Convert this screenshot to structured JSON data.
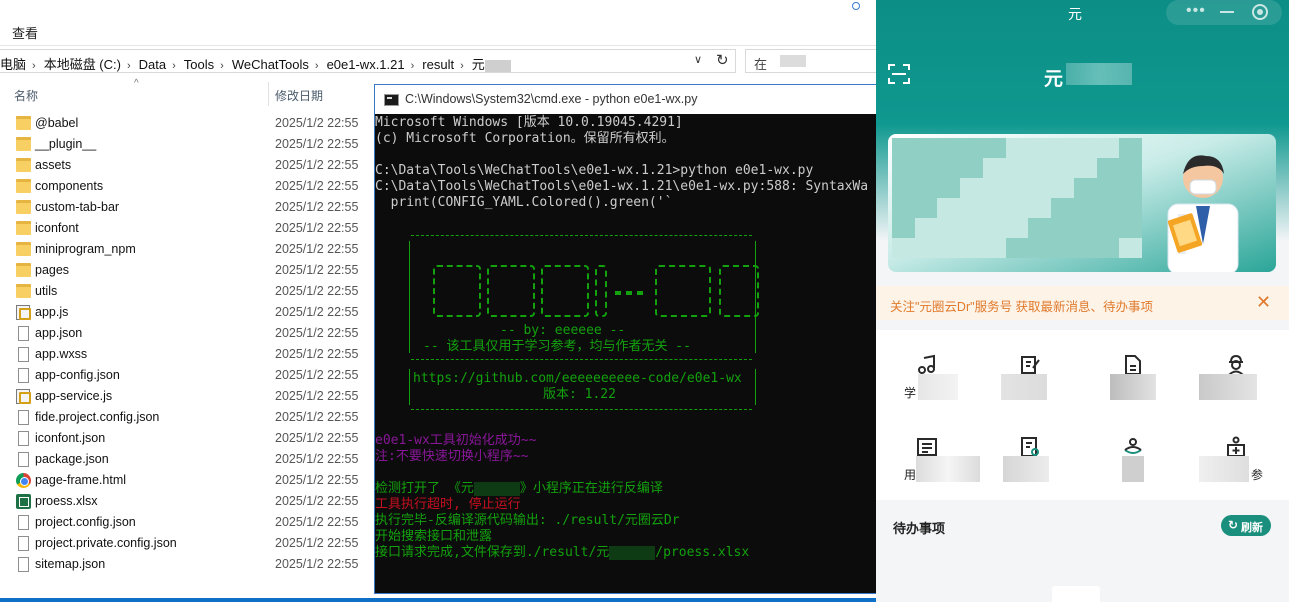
{
  "explorer": {
    "menu": "查看",
    "breadcrumb": [
      "电脑",
      "本地磁盘 (C:)",
      "Data",
      "Tools",
      "WeChatTools",
      "e0e1-wx.1.21",
      "result",
      "元"
    ],
    "search_placeholder": "在",
    "columns": {
      "name": "名称",
      "date": "修改日期"
    },
    "files": [
      {
        "name": "@babel",
        "date": "2025/1/2 22:55",
        "kind": "folder"
      },
      {
        "name": "__plugin__",
        "date": "2025/1/2 22:55",
        "kind": "folder"
      },
      {
        "name": "assets",
        "date": "2025/1/2 22:55",
        "kind": "folder"
      },
      {
        "name": "components",
        "date": "2025/1/2 22:55",
        "kind": "folder"
      },
      {
        "name": "custom-tab-bar",
        "date": "2025/1/2 22:55",
        "kind": "folder"
      },
      {
        "name": "iconfont",
        "date": "2025/1/2 22:55",
        "kind": "folder"
      },
      {
        "name": "miniprogram_npm",
        "date": "2025/1/2 22:55",
        "kind": "folder"
      },
      {
        "name": "pages",
        "date": "2025/1/2 22:55",
        "kind": "folder"
      },
      {
        "name": "utils",
        "date": "2025/1/2 22:55",
        "kind": "folder"
      },
      {
        "name": "app.js",
        "date": "2025/1/2 22:55",
        "kind": "js"
      },
      {
        "name": "app.json",
        "date": "2025/1/2 22:55",
        "kind": "file"
      },
      {
        "name": "app.wxss",
        "date": "2025/1/2 22:55",
        "kind": "file"
      },
      {
        "name": "app-config.json",
        "date": "2025/1/2 22:55",
        "kind": "file"
      },
      {
        "name": "app-service.js",
        "date": "2025/1/2 22:55",
        "kind": "js"
      },
      {
        "name": "fide.project.config.json",
        "date": "2025/1/2 22:55",
        "kind": "file"
      },
      {
        "name": "iconfont.json",
        "date": "2025/1/2 22:55",
        "kind": "file"
      },
      {
        "name": "package.json",
        "date": "2025/1/2 22:55",
        "kind": "file"
      },
      {
        "name": "page-frame.html",
        "date": "2025/1/2 22:55",
        "kind": "chrome"
      },
      {
        "name": "proess.xlsx",
        "date": "2025/1/2 22:55",
        "kind": "xlsx"
      },
      {
        "name": "project.config.json",
        "date": "2025/1/2 22:55",
        "kind": "file"
      },
      {
        "name": "project.private.config.json",
        "date": "2025/1/2 22:55",
        "kind": "file"
      },
      {
        "name": "sitemap.json",
        "date": "2025/1/2 22:55",
        "kind": "file"
      }
    ]
  },
  "cmd": {
    "title": "C:\\Windows\\System32\\cmd.exe - python  e0e1-wx.py",
    "header1": "Microsoft Windows [版本 10.0.19045.4291]",
    "header2": "(c) Microsoft Corporation。保留所有权利。",
    "prompt": "C:\\Data\\Tools\\WeChatTools\\e0e1-wx.1.21>python e0e1-wx.py",
    "warn1": "C:\\Data\\Tools\\WeChatTools\\e0e1-wx.1.21\\e0e1-wx.py:588: SyntaxWa",
    "warn2": "  print(CONFIG_YAML.Colored().green('`",
    "banner_by": "-- by: eeeeee --",
    "banner_note": "-- 该工具仅用于学习参考，均与作者无关 --",
    "banner_url": "https://github.com/eeeeeeeeee-code/e0e1-wx",
    "banner_version": "版本: 1.22",
    "init_ok": "e0e1-wx工具初始化成功~~",
    "init_note": "注:不要快速切换小程序~~",
    "detect_a": "检测打开了 《元",
    "detect_b": "》小程序正在进行反编译",
    "timeout": "工具执行超时, 停止运行",
    "done": "执行完毕-反编译源代码输出: ./result/元圈云Dr",
    "leak": "开始搜索接口和泄露",
    "saved_a": "接口请求完成,文件保存到./result/元",
    "saved_b": "/proess.xlsx"
  },
  "mini": {
    "window_title": "元",
    "app_title": "元",
    "notice": "关注\"元圈云Dr\"服务号 获取最新消息、待办事项",
    "grid": [
      {
        "label": "学",
        "icon": "music-note-icon"
      },
      {
        "label": "",
        "icon": "edit-doc-icon"
      },
      {
        "label": "",
        "icon": "document-icon"
      },
      {
        "label": "",
        "icon": "doctor-icon"
      },
      {
        "label": "用",
        "icon": "list-icon"
      },
      {
        "label": "",
        "icon": "id-card-icon"
      },
      {
        "label": "",
        "icon": "rotate-person-icon"
      },
      {
        "label": "参",
        "icon": "medical-bag-icon"
      }
    ],
    "todo_title": "待办事项",
    "refresh": "刷新"
  }
}
